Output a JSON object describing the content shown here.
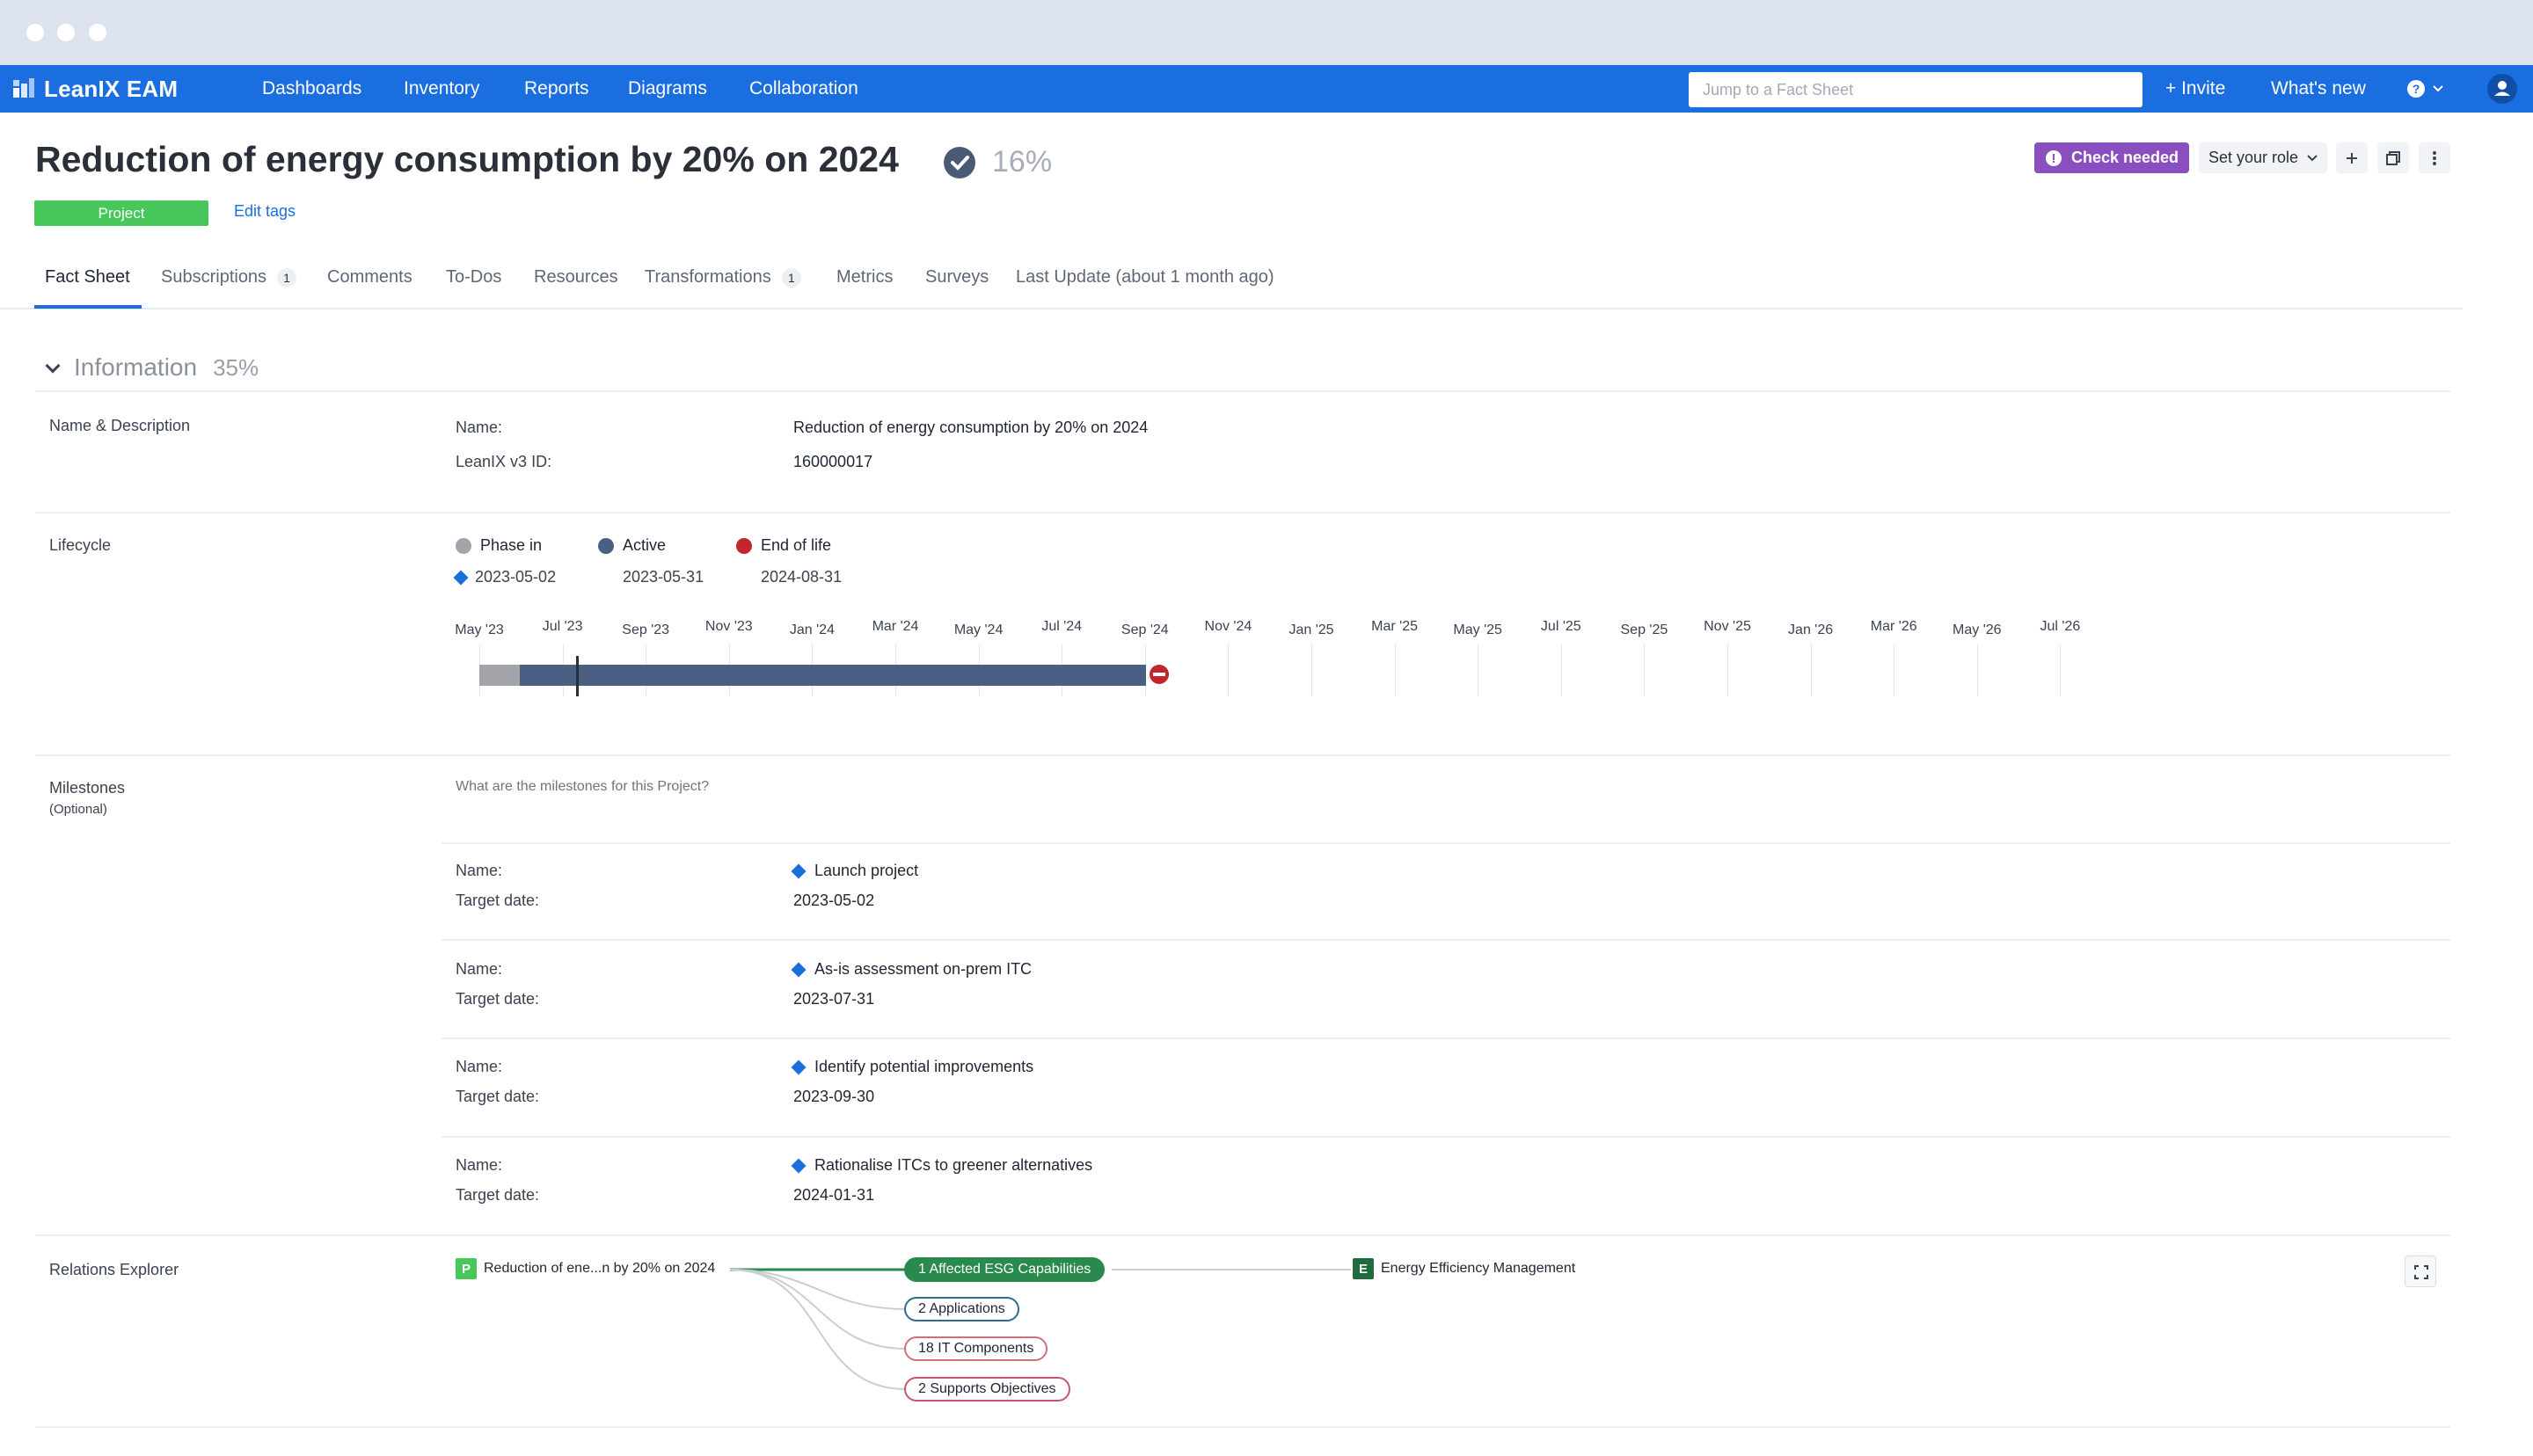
{
  "app": {
    "name": "LeanIX EAM"
  },
  "nav": {
    "items": [
      "Dashboards",
      "Inventory",
      "Reports",
      "Diagrams",
      "Collaboration"
    ],
    "search_placeholder": "Jump to a Fact Sheet",
    "invite": "+ Invite",
    "whats_new": "What's new"
  },
  "factsheet": {
    "title": "Reduction of energy consumption by 20% on 2024",
    "completion": "16%",
    "type": "Project",
    "edit_tags": "Edit tags",
    "check_needed": "Check needed",
    "role": "Set your role"
  },
  "tabs": [
    {
      "label": "Fact Sheet"
    },
    {
      "label": "Subscriptions",
      "count": "1"
    },
    {
      "label": "Comments"
    },
    {
      "label": "To-Dos"
    },
    {
      "label": "Resources"
    },
    {
      "label": "Transformations",
      "count": "1"
    },
    {
      "label": "Metrics"
    },
    {
      "label": "Surveys"
    },
    {
      "label": "Last Update (about 1 month ago)"
    }
  ],
  "information": {
    "title": "Information",
    "pct": "35%",
    "name_desc": {
      "label": "Name & Description",
      "name_key": "Name:",
      "name_val": "Reduction of energy consumption by 20% on 2024",
      "id_key": "LeanIX v3 ID:",
      "id_val": "160000017"
    }
  },
  "lifecycle": {
    "label": "Lifecycle",
    "phases": [
      {
        "name": "Phase in",
        "date": "2023-05-02",
        "color": "#a3a5aa"
      },
      {
        "name": "Active",
        "date": "2023-05-31",
        "color": "#4a5f82"
      },
      {
        "name": "End of life",
        "date": "2024-08-31",
        "color": "#c0262c"
      }
    ],
    "ticks": [
      "May '23",
      "Jul '23",
      "Sep '23",
      "Nov '23",
      "Jan '24",
      "Mar '24",
      "May '24",
      "Jul '24",
      "Sep '24",
      "Nov '24",
      "Jan '25",
      "Mar '25",
      "May '25",
      "Jul '25",
      "Sep '25",
      "Nov '25",
      "Jan '26",
      "Mar '26",
      "May '26",
      "Jul '26"
    ]
  },
  "milestones": {
    "label": "Milestones",
    "optional": "(Optional)",
    "question": "What are the milestones for this Project?",
    "name_key": "Name:",
    "date_key": "Target date:",
    "items": [
      {
        "name": "Launch project",
        "date": "2023-05-02"
      },
      {
        "name": "As-is assessment on-prem ITC",
        "date": "2023-07-31"
      },
      {
        "name": "Identify potential improvements",
        "date": "2023-09-30"
      },
      {
        "name": "Rationalise ITCs to greener alternatives",
        "date": "2024-01-31"
      }
    ]
  },
  "relations": {
    "label": "Relations Explorer",
    "source": {
      "badge": "P",
      "name": "Reduction of ene...n by 20% on 2024"
    },
    "pills": [
      "1 Affected ESG Capabilities",
      "2 Applications",
      "18 IT Components",
      "2 Supports Objectives"
    ],
    "target": {
      "badge": "E",
      "name": "Energy Efficiency Management"
    }
  }
}
